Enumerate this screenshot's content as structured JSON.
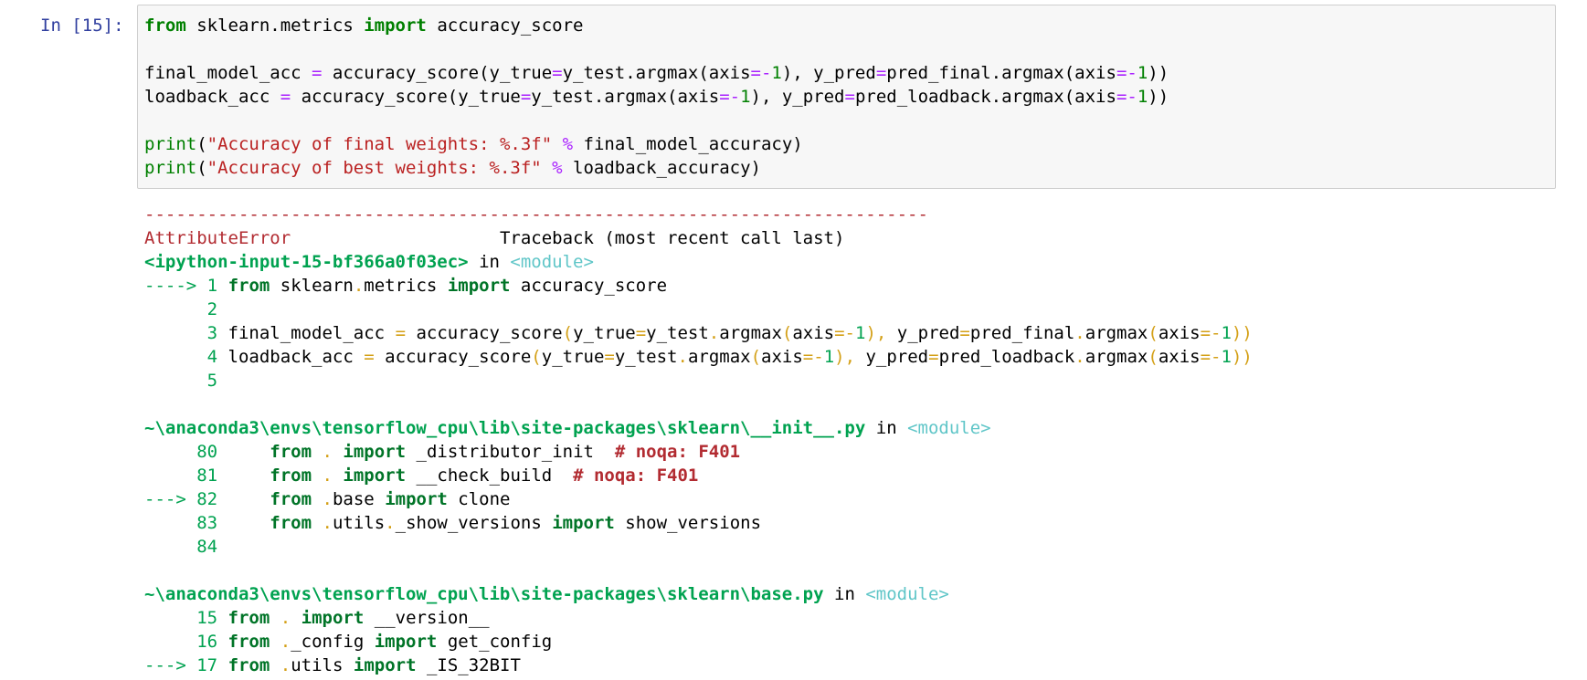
{
  "cell": {
    "prompt": "In [15]:",
    "code_lines": [
      "from sklearn.metrics import accuracy_score",
      "",
      "final_model_acc = accuracy_score(y_true=y_test.argmax(axis=-1), y_pred=pred_final.argmax(axis=-1))",
      "loadback_acc = accuracy_score(y_true=y_test.argmax(axis=-1), y_pred=pred_loadback.argmax(axis=-1))",
      "",
      "print(\"Accuracy of final weights: %.3f\" % final_model_accuracy)",
      "print(\"Accuracy of best weights: %.3f\" % loadback_accuracy)"
    ]
  },
  "traceback": {
    "divider": "---------------------------------------------------------------------------",
    "error_type": "AttributeError",
    "header_right": "Traceback (most recent call last)",
    "frames": [
      {
        "location": "<ipython-input-15-bf366a0f03ec>",
        "in_text": "in",
        "scope": "<module>",
        "lines": [
          {
            "marker": "---->",
            "num": "1",
            "text": "from sklearn.metrics import accuracy_score"
          },
          {
            "marker": "",
            "num": "2",
            "text": ""
          },
          {
            "marker": "",
            "num": "3",
            "text": "final_model_acc = accuracy_score(y_true=y_test.argmax(axis=-1), y_pred=pred_final.argmax(axis=-1))"
          },
          {
            "marker": "",
            "num": "4",
            "text": "loadback_acc = accuracy_score(y_true=y_test.argmax(axis=-1), y_pred=pred_loadback.argmax(axis=-1))"
          },
          {
            "marker": "",
            "num": "5",
            "text": ""
          }
        ]
      },
      {
        "location": "~\\anaconda3\\envs\\tensorflow_cpu\\lib\\site-packages\\sklearn\\__init__.py",
        "in_text": "in",
        "scope": "<module>",
        "lines": [
          {
            "marker": "",
            "num": "80",
            "text": "    from . import _distributor_init  # noqa: F401"
          },
          {
            "marker": "",
            "num": "81",
            "text": "    from . import __check_build  # noqa: F401"
          },
          {
            "marker": "--->",
            "num": "82",
            "text": "    from .base import clone"
          },
          {
            "marker": "",
            "num": "83",
            "text": "    from .utils._show_versions import show_versions"
          },
          {
            "marker": "",
            "num": "84",
            "text": ""
          }
        ]
      },
      {
        "location": "~\\anaconda3\\envs\\tensorflow_cpu\\lib\\site-packages\\sklearn\\base.py",
        "in_text": "in",
        "scope": "<module>",
        "lines": [
          {
            "marker": "",
            "num": "15",
            "text": "from . import __version__"
          },
          {
            "marker": "",
            "num": "16",
            "text": "from ._config import get_config"
          },
          {
            "marker": "--->",
            "num": "17",
            "text": "from .utils import _IS_32BIT"
          }
        ]
      }
    ]
  },
  "colors": {
    "prompt": "#303f9f",
    "keyword": "#008000",
    "string": "#ba2121",
    "operator": "#aa22ff",
    "traceback_red": "#b22b31",
    "traceback_green": "#00a250",
    "module_cyan": "#60c6c8"
  }
}
